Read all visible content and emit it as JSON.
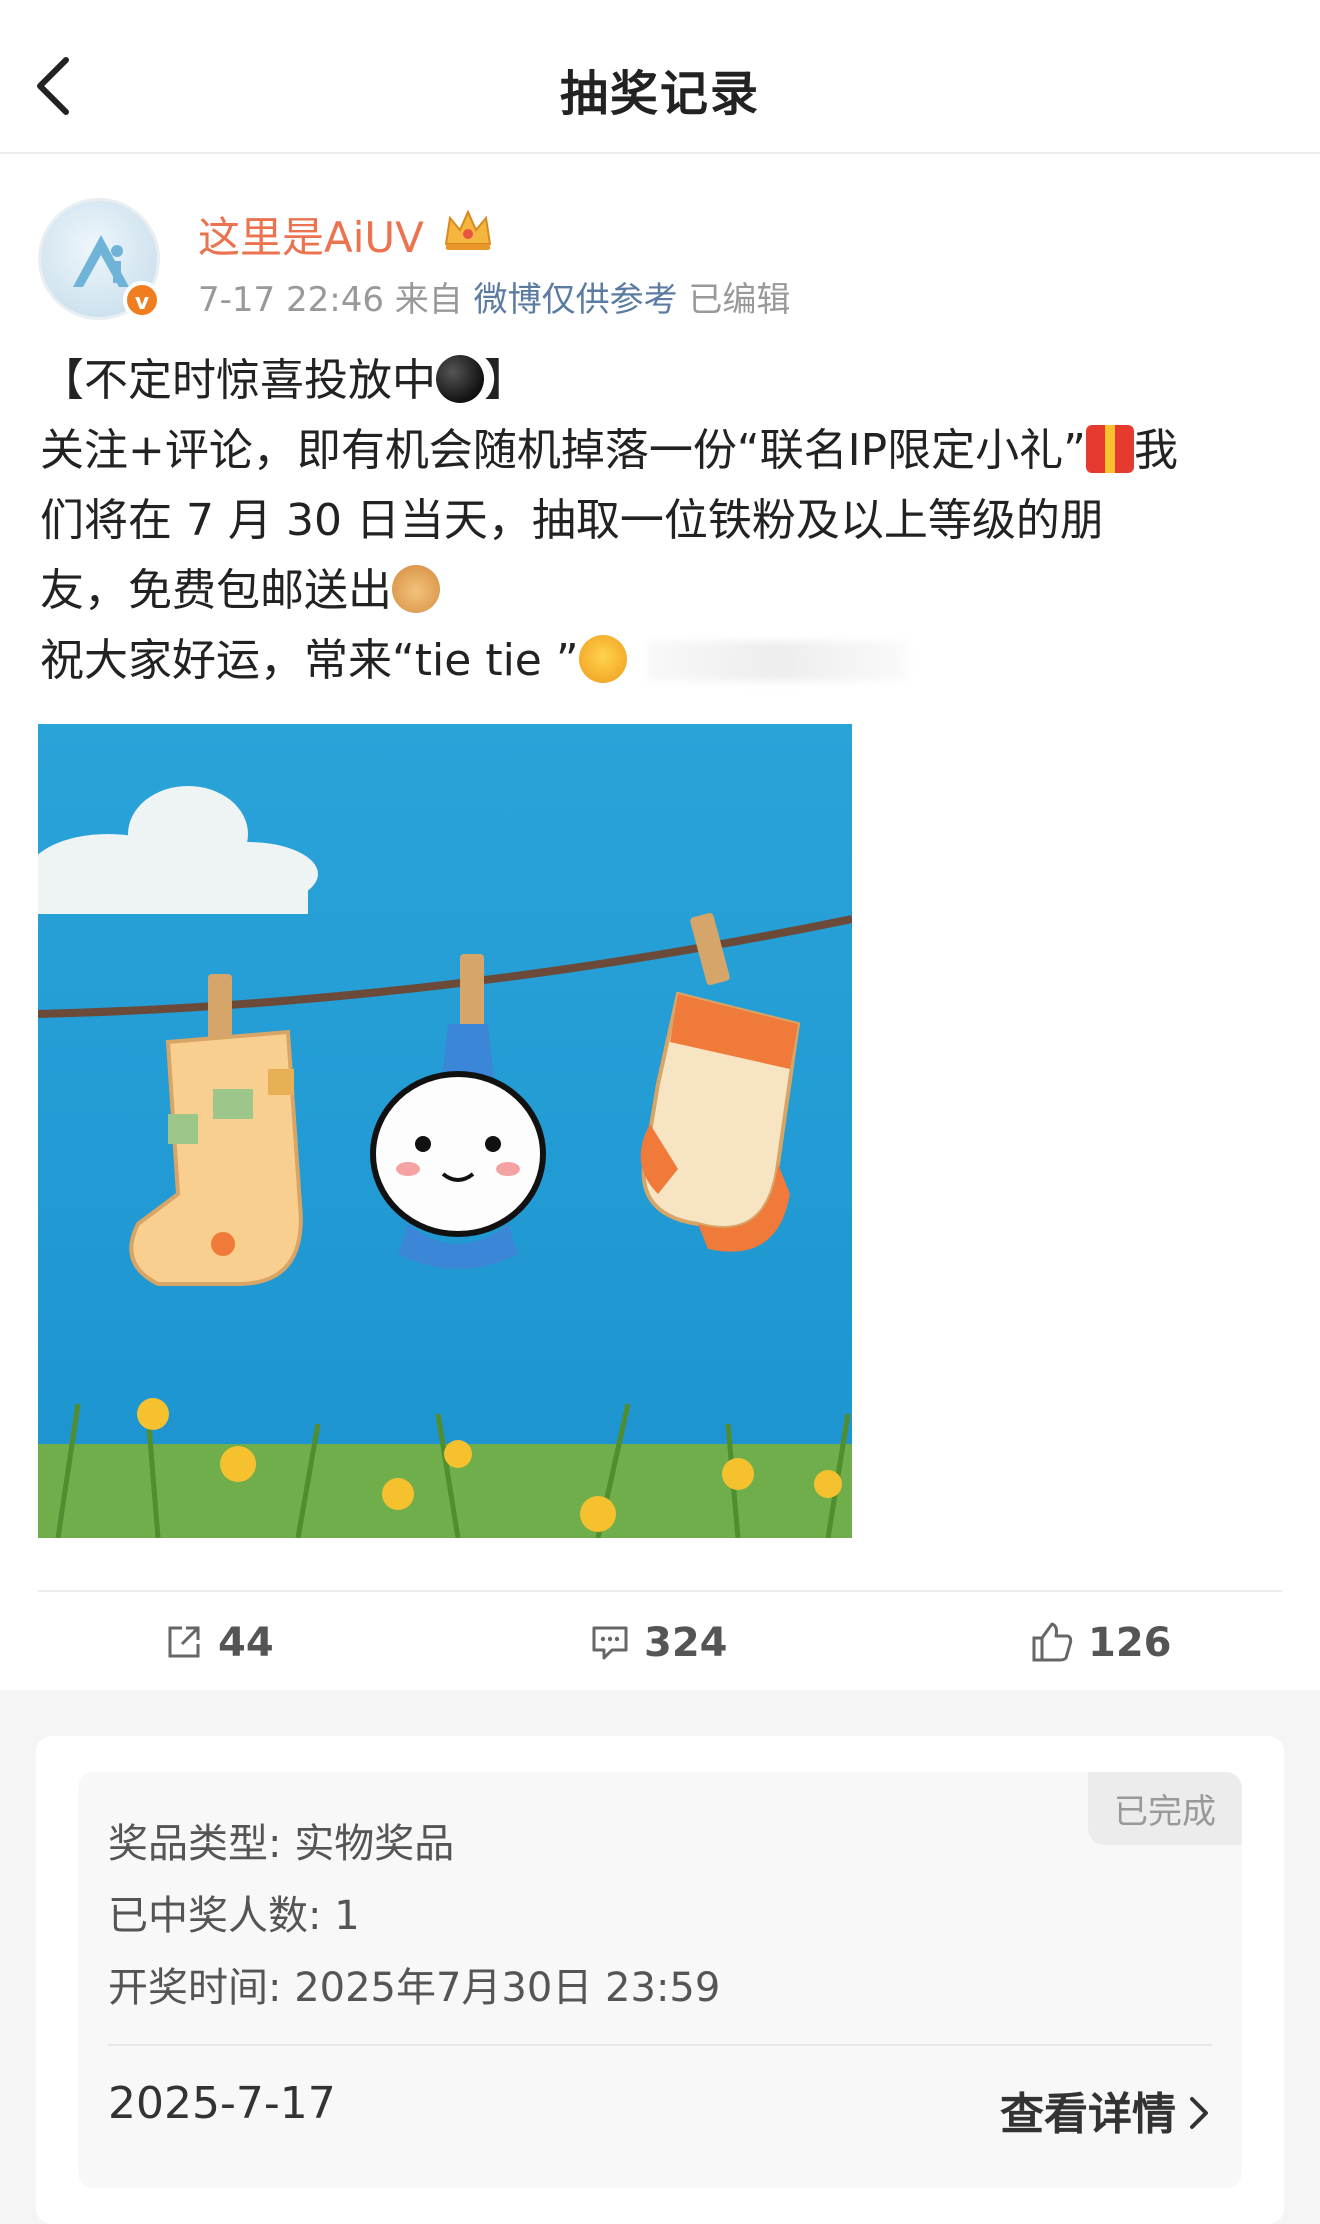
{
  "nav": {
    "title": "抽奖记录",
    "back_icon": "chevron-left-icon"
  },
  "post": {
    "username": "这里是AiUV",
    "crown_icon": "crown-icon",
    "time": "7-17 22:46",
    "from_prefix": "来自",
    "source": "微博仅供参考",
    "edited": "已编辑",
    "content": {
      "line1": "【不定时惊喜投放中",
      "line1_end": "】",
      "line2_a": "关注+评论，即有机会随机掉落一份“联名IP限定小礼”",
      "line2_b": "我",
      "line3": "们将在 7 月 30 日当天，抽取一位铁粉及以上等级的朋",
      "line4": "友，免费包邮送出",
      "line5": "祝大家好运，常来“tie tie ”"
    },
    "stats": {
      "reposts": "44",
      "comments": "324",
      "likes": "126"
    }
  },
  "lottery": {
    "status": "已完成",
    "prize_type": "奖品类型: 实物奖品",
    "winners": "已中奖人数: 1",
    "draw_time": "开奖时间: 2025年7月30日 23:59",
    "date": "2025-7-17",
    "detail_label": "查看详情"
  }
}
